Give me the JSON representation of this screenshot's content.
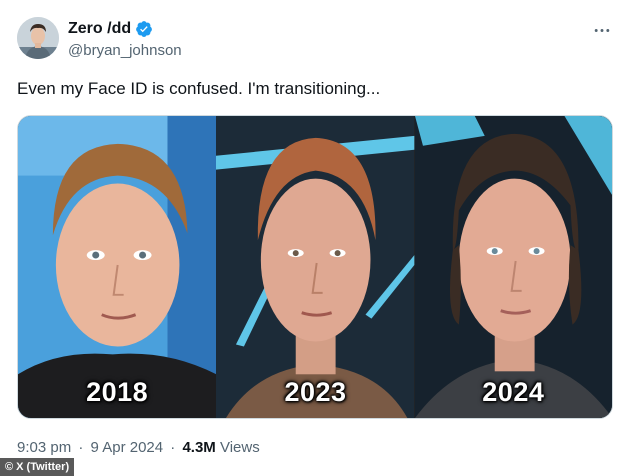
{
  "author": {
    "display_name": "Zero /dd",
    "handle": "@bryan_johnson",
    "verified_icon": "verified-badge-icon"
  },
  "more_icon": "more-options-icon",
  "tweet": {
    "text": "Even my Face ID is confused. I'm transitioning..."
  },
  "media": {
    "panels": [
      {
        "year": "2018"
      },
      {
        "year": "2023"
      },
      {
        "year": "2024"
      }
    ]
  },
  "meta": {
    "time": "9:03 pm",
    "separator": "·",
    "date": "9 Apr 2024",
    "views_count": "4.3M",
    "views_label": "Views"
  },
  "watermark": "© X (Twitter)",
  "colors": {
    "verified": "#1d9bf0",
    "secondary_text": "#536471",
    "primary_text": "#0f1419"
  }
}
